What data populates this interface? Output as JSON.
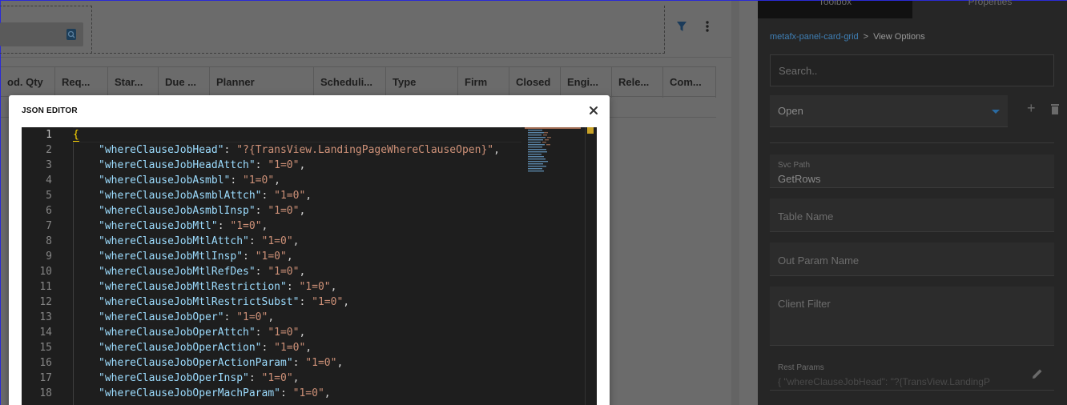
{
  "grid": {
    "columns": [
      "od. Qty",
      "Req...",
      "Star...",
      "Due ...",
      "Planner",
      "Scheduli...",
      "Type",
      "Firm",
      "Closed",
      "Engi...",
      "Rele...",
      "Com..."
    ]
  },
  "props": {
    "tabs": [
      "Toolbox",
      "Properties"
    ],
    "breadcrumb": {
      "link": "metafx-panel-card-grid",
      "separator": ">",
      "current": "View Options"
    },
    "search_placeholder": "Search..",
    "view_select_value": "Open",
    "svc_path": {
      "label": "Svc Path",
      "value": "GetRows"
    },
    "table_name_placeholder": "Table Name",
    "out_param_placeholder": "Out Param Name",
    "client_filter_placeholder": "Client Filter",
    "rest_params": {
      "label": "Rest Params",
      "value": "{ \"whereClauseJobHead\": \"?{TransView.LandingP"
    }
  },
  "modal": {
    "title": "JSON EDITOR",
    "close_icon": "close-icon"
  },
  "editor": {
    "lines": [
      {
        "n": "1",
        "key": "",
        "val": "",
        "open": true
      },
      {
        "n": "2",
        "key": "whereClauseJobHead",
        "val": "?{TransView.LandingPageWhereClauseOpen}"
      },
      {
        "n": "3",
        "key": "whereClauseJobHeadAttch",
        "val": "1=0"
      },
      {
        "n": "4",
        "key": "whereClauseJobAsmbl",
        "val": "1=0"
      },
      {
        "n": "5",
        "key": "whereClauseJobAsmblAttch",
        "val": "1=0"
      },
      {
        "n": "6",
        "key": "whereClauseJobAsmblInsp",
        "val": "1=0"
      },
      {
        "n": "7",
        "key": "whereClauseJobMtl",
        "val": "1=0"
      },
      {
        "n": "8",
        "key": "whereClauseJobMtlAttch",
        "val": "1=0"
      },
      {
        "n": "9",
        "key": "whereClauseJobMtlInsp",
        "val": "1=0"
      },
      {
        "n": "10",
        "key": "whereClauseJobMtlRefDes",
        "val": "1=0"
      },
      {
        "n": "11",
        "key": "whereClauseJobMtlRestriction",
        "val": "1=0"
      },
      {
        "n": "12",
        "key": "whereClauseJobMtlRestrictSubst",
        "val": "1=0"
      },
      {
        "n": "13",
        "key": "whereClauseJobOper",
        "val": "1=0"
      },
      {
        "n": "14",
        "key": "whereClauseJobOperAttch",
        "val": "1=0"
      },
      {
        "n": "15",
        "key": "whereClauseJobOperAction",
        "val": "1=0"
      },
      {
        "n": "16",
        "key": "whereClauseJobOperActionParam",
        "val": "1=0"
      },
      {
        "n": "17",
        "key": "whereClauseJobOperInsp",
        "val": "1=0"
      },
      {
        "n": "18",
        "key": "whereClauseJobOperMachParam",
        "val": "1=0"
      }
    ]
  },
  "colors": {
    "accent": "#2a6aa0",
    "json_key": "#9cdcfe",
    "json_string": "#ce9178",
    "brace": "#ffd700"
  }
}
